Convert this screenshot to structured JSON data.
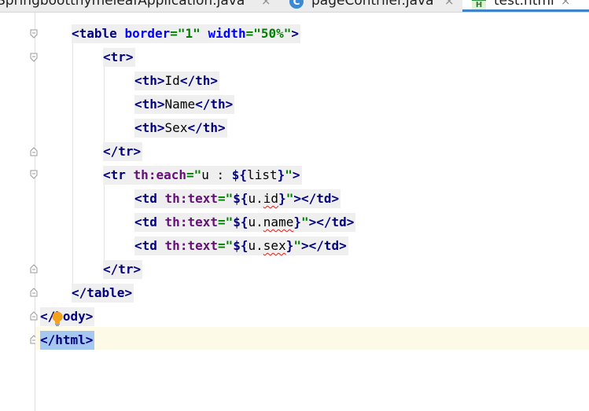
{
  "tabs": [
    {
      "label": "SpringbootthymeleafApplication.java",
      "close": "×",
      "icon": "none",
      "active": false
    },
    {
      "label": "pageContrller.java",
      "close": "×",
      "icon": "java-class-icon",
      "icon_letter": "C",
      "active": false
    },
    {
      "label": "test.html",
      "close": "×",
      "icon": "html-file-icon",
      "icon_letter": "H",
      "active": true
    }
  ],
  "colors": {
    "tag": "#000080",
    "attr_name": "#0000ff",
    "attr_value": "#008000",
    "thymeleaf_attr": "#660e7a",
    "caret_line": "#fdfbe7",
    "selection": "#a6c8f0",
    "tab_accent": "#4083c9"
  },
  "code": {
    "l1": {
      "open": "<",
      "tag": "table",
      "a1": "border",
      "eq1": "=",
      "v1": "\"1\"",
      "a2": "width",
      "eq2": "=",
      "v2": "\"50%\"",
      "close": ">"
    },
    "l2": {
      "open": "<",
      "tag": "tr",
      "close": ">"
    },
    "l3": {
      "open": "<",
      "tag": "th",
      "close": ">",
      "text": "Id",
      "end_open": "</",
      "end_tag": "th",
      "end_close": ">"
    },
    "l4": {
      "open": "<",
      "tag": "th",
      "close": ">",
      "text": "Name",
      "end_open": "</",
      "end_tag": "th",
      "end_close": ">"
    },
    "l5": {
      "open": "<",
      "tag": "th",
      "close": ">",
      "text": "Sex",
      "end_open": "</",
      "end_tag": "th",
      "end_close": ">"
    },
    "l6": {
      "open": "</",
      "tag": "tr",
      "close": ">"
    },
    "l7": {
      "open": "<",
      "tag": "tr",
      "attr": "th:each",
      "eq": "=",
      "q1": "\"",
      "val": "u : ",
      "expr_open": "${",
      "expr": "list",
      "expr_close": "}",
      "q2": "\"",
      "close": ">"
    },
    "l8": {
      "open": "<",
      "tag": "td",
      "attr": "th:text",
      "eq": "=",
      "q1": "\"",
      "expr_open": "${",
      "obj": "u.",
      "prop": "id",
      "expr_close": "}",
      "q2": "\"",
      "close": ">",
      "end_open": "</",
      "end_tag": "td",
      "end_close": ">"
    },
    "l9": {
      "open": "<",
      "tag": "td",
      "attr": "th:text",
      "eq": "=",
      "q1": "\"",
      "expr_open": "${",
      "obj": "u.",
      "prop": "name",
      "expr_close": "}",
      "q2": "\"",
      "close": ">",
      "end_open": "</",
      "end_tag": "td",
      "end_close": ">"
    },
    "l10": {
      "open": "<",
      "tag": "td",
      "attr": "th:text",
      "eq": "=",
      "q1": "\"",
      "expr_open": "${",
      "obj": "u.",
      "prop": "sex",
      "expr_close": "}",
      "q2": "\"",
      "close": ">",
      "end_open": "</",
      "end_tag": "td",
      "end_close": ">"
    },
    "l11": {
      "open": "</",
      "tag": "tr",
      "close": ">"
    },
    "l12": {
      "open": "</",
      "tag": "table",
      "close": ">"
    },
    "l13": {
      "open": "</",
      "tag": "body",
      "close": ">",
      "visible_tag": "ody"
    },
    "l14": {
      "open": "</",
      "tag": "html",
      "close": ">"
    }
  },
  "gutter_icons": {
    "fold_open": "fold-open-icon",
    "fold_close": "fold-close-icon",
    "intention": "lightbulb-icon"
  }
}
